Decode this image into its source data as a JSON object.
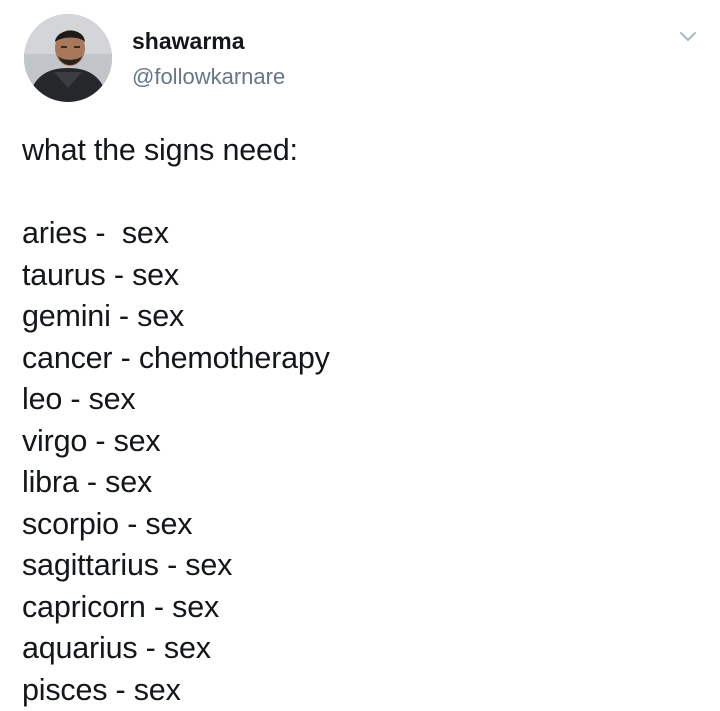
{
  "tweet": {
    "author": {
      "display_name": "shawarma",
      "handle": "@followkarnare",
      "avatar_icon": "user-avatar-photo"
    },
    "menu_icon": "chevron-down-icon",
    "text": {
      "intro": "what the signs need:",
      "lines": [
        "aries -  sex",
        "taurus - sex",
        "gemini - sex",
        "cancer - chemotherapy",
        "leo - sex",
        "virgo - sex",
        "libra - sex",
        "scorpio - sex",
        "sagittarius - sex",
        "capricorn - sex",
        "aquarius - sex",
        "pisces - sex"
      ]
    }
  },
  "colors": {
    "text": "#14171a",
    "handle": "#657786",
    "caret": "#aab8c2",
    "background": "#ffffff"
  }
}
